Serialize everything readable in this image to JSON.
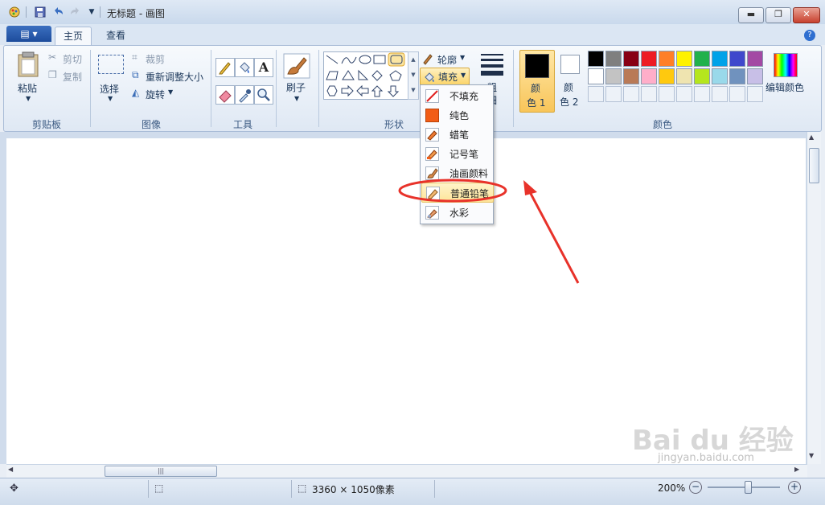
{
  "window": {
    "title": "无标题 - 画图"
  },
  "quick_access": {
    "icons": [
      "paint-app-icon",
      "save-icon",
      "undo-icon",
      "redo-icon",
      "dropdown-icon"
    ]
  },
  "tabs": [
    {
      "label": "主页"
    },
    {
      "label": "查看"
    }
  ],
  "ribbon": {
    "clipboard": {
      "paste": "粘贴",
      "cut": "剪切",
      "copy": "复制",
      "group": "剪贴板"
    },
    "image": {
      "select": "选择",
      "crop": "裁剪",
      "resize": "重新调整大小",
      "rotate": "旋转",
      "group": "图像"
    },
    "tools": {
      "group": "工具"
    },
    "brushes": {
      "label": "刷子"
    },
    "shapes": {
      "outline": "轮廓",
      "fill": "填充",
      "group": "形状"
    },
    "size": {
      "label_top": "粗",
      "label_bottom": "细"
    },
    "colors": {
      "color1_a": "颜",
      "color1_b": "色 1",
      "color2_a": "颜",
      "color2_b": "色 2",
      "edit": "编辑颜色",
      "group": "颜色",
      "color1_value": "#000000",
      "color2_value": "#ffffff",
      "palette_row1": [
        "#000000",
        "#7f7f7f",
        "#880015",
        "#ed1c24",
        "#ff7f27",
        "#fff200",
        "#22b14c",
        "#00a2e8",
        "#3f48cc",
        "#a349a4"
      ],
      "palette_row2": [
        "#ffffff",
        "#c3c3c3",
        "#b97a57",
        "#ffaec9",
        "#ffc90e",
        "#efe4b0",
        "#b5e61d",
        "#99d9ea",
        "#7092be",
        "#c8bfe7"
      ]
    }
  },
  "fill_menu": {
    "items": [
      {
        "label": "不填充",
        "icon": "no-fill-icon"
      },
      {
        "label": "纯色",
        "icon": "solid-color-icon"
      },
      {
        "label": "蜡笔",
        "icon": "crayon-icon"
      },
      {
        "label": "记号笔",
        "icon": "marker-icon"
      },
      {
        "label": "油画颜料",
        "icon": "oil-paint-icon"
      },
      {
        "label": "普通铅笔",
        "icon": "pencil-icon"
      },
      {
        "label": "水彩",
        "icon": "watercolor-icon"
      }
    ],
    "highlighted": "普通铅笔"
  },
  "status": {
    "dimensions": "3360 × 1050像素",
    "zoom": "200%"
  },
  "watermark": {
    "brand": "Bai du 经验",
    "url": "jingyan.baidu.com"
  },
  "accent": {
    "annotation": "#e8322a"
  }
}
